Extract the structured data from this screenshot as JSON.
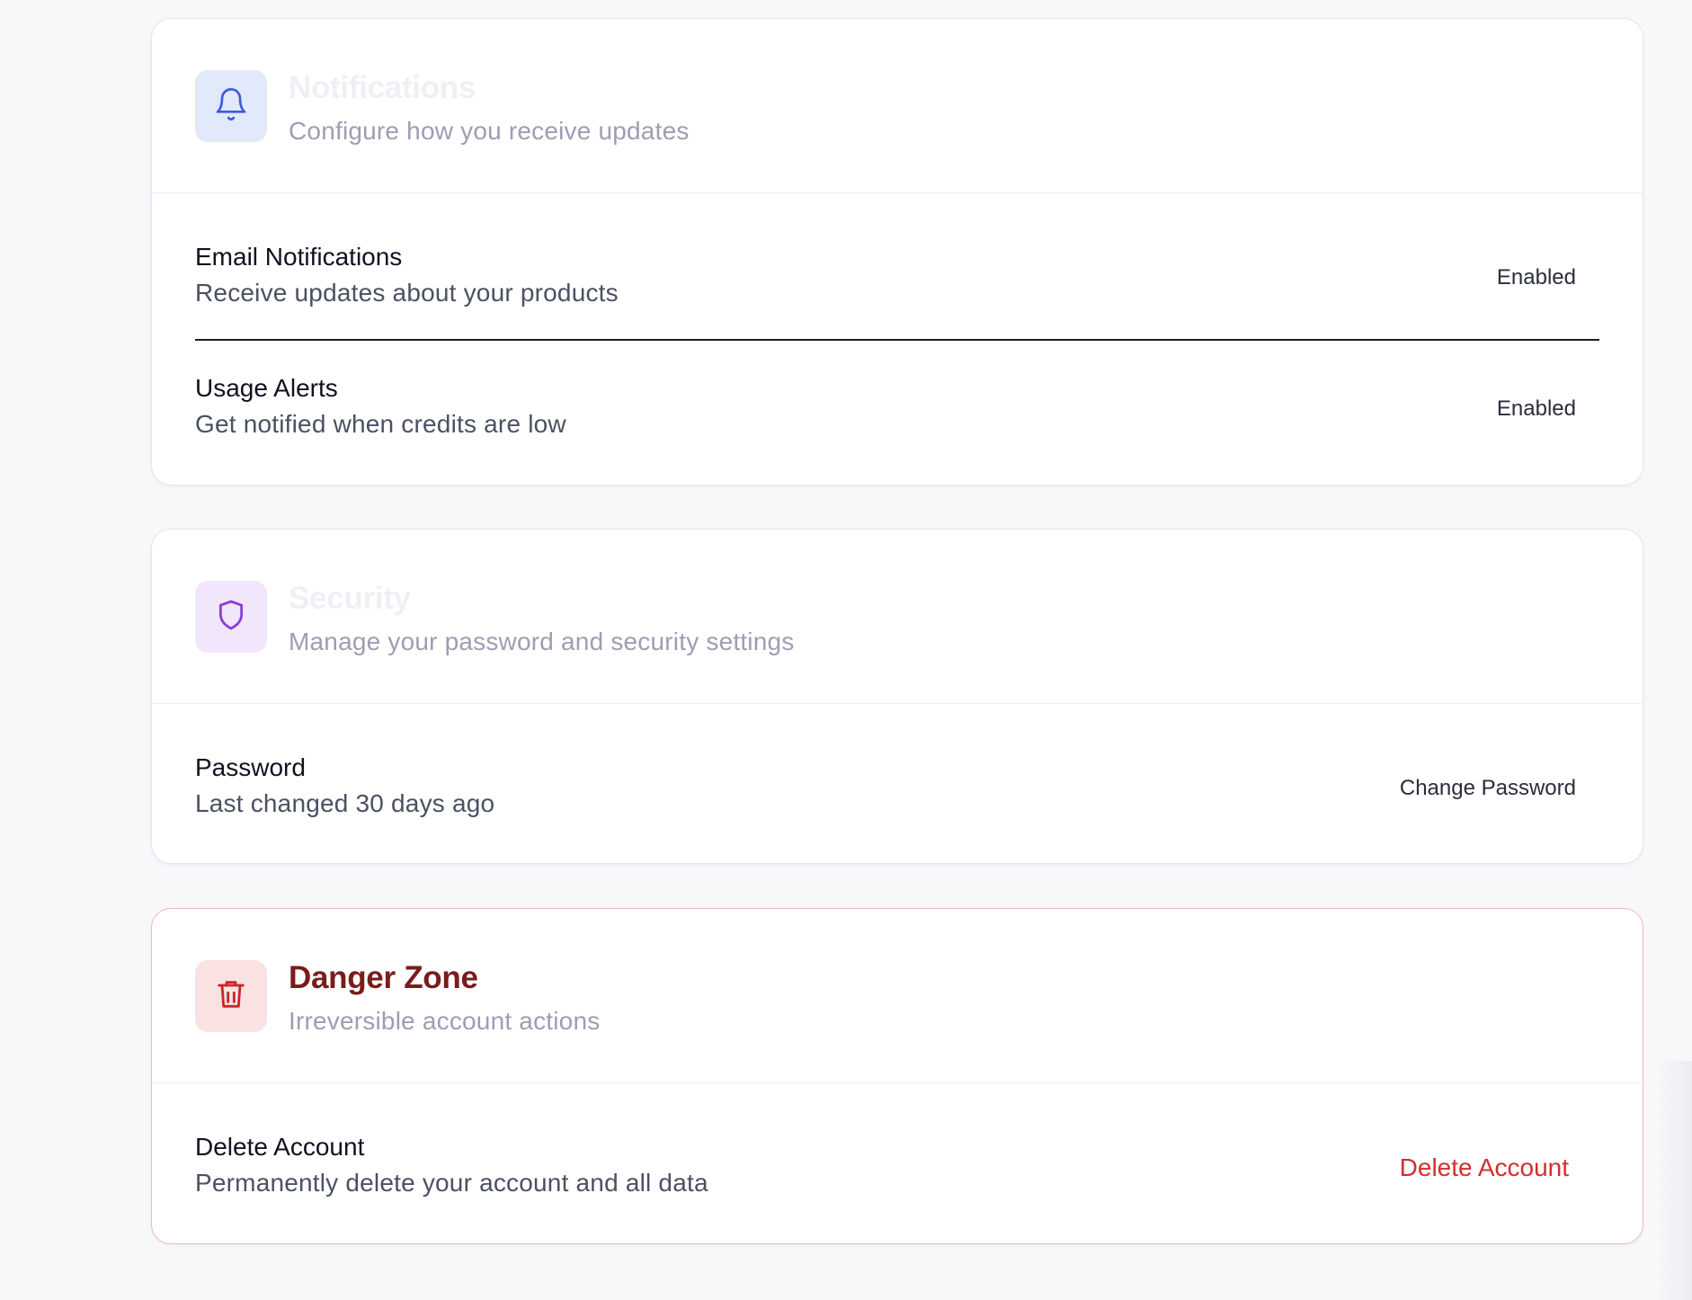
{
  "notifications": {
    "icon": "bell-icon",
    "icon_color": "#3b5bdb",
    "tile_bg": "#e1e9fb",
    "title": "Notifications",
    "subtitle": "Configure how you receive updates",
    "items": [
      {
        "title": "Email Notifications",
        "description": "Receive updates about your products",
        "action": "Enabled"
      },
      {
        "title": "Usage Alerts",
        "description": "Get notified when credits are low",
        "action": "Enabled"
      }
    ]
  },
  "security": {
    "icon": "shield-icon",
    "icon_color": "#8a3fd6",
    "tile_bg": "#f1e6fb",
    "title": "Security",
    "subtitle": "Manage your password and security settings",
    "items": [
      {
        "title": "Password",
        "description": "Last changed 30 days ago",
        "action": "Change Password"
      }
    ]
  },
  "danger": {
    "icon": "trash-icon",
    "icon_color": "#c62828",
    "tile_bg": "#fbe2e2",
    "title": "Danger Zone",
    "title_color": "#7a1c1c",
    "subtitle": "Irreversible account actions",
    "border_color": "#f2b9bb",
    "items": [
      {
        "title": "Delete Account",
        "description": "Permanently delete your account and all data",
        "action": "Delete Account",
        "action_color": "#d32f2f"
      }
    ]
  }
}
